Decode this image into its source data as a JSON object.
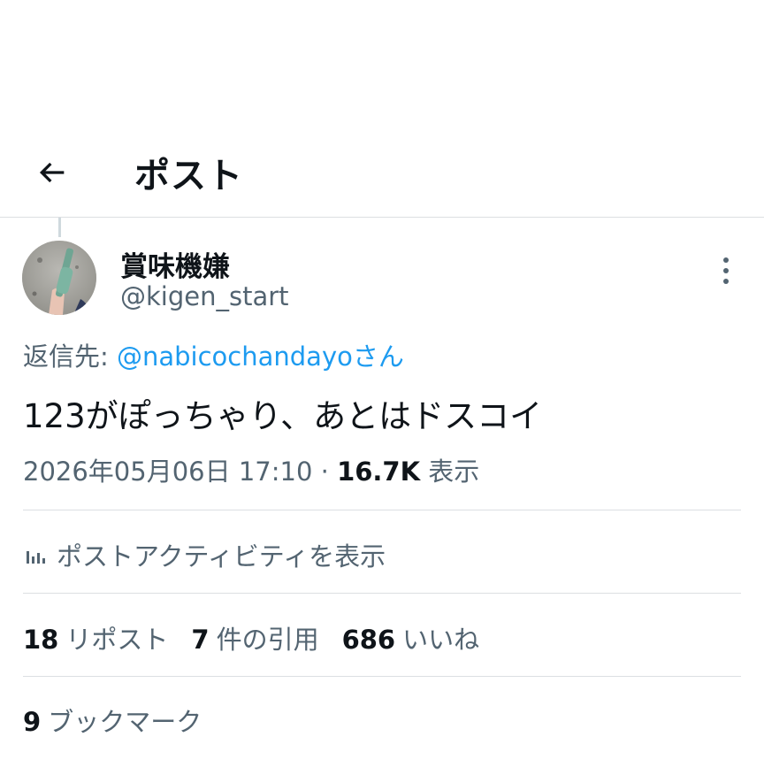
{
  "header": {
    "title": "ポスト",
    "back_icon": "arrow-left-icon"
  },
  "author": {
    "display_name": "賞味機嫌",
    "handle": "@kigen_start"
  },
  "reply": {
    "label": "返信先: ",
    "mention": "@nabicochandayo",
    "suffix": "さん"
  },
  "tweet": {
    "text": "123がぽっちゃり、あとはドスコイ",
    "datetime": "2026年05月06日 17:10",
    "separator": " · ",
    "views_count": "16.7K",
    "views_label": " 表示"
  },
  "activity": {
    "label": "ポストアクティビティを表示",
    "icon": "bar-chart-icon"
  },
  "stats": {
    "reposts_count": "18",
    "reposts_label": "リポスト",
    "quotes_count": "7",
    "quotes_label": "件の引用",
    "likes_count": "686",
    "likes_label": "いいね"
  },
  "bookmarks": {
    "count": "9",
    "label": "ブックマーク"
  },
  "colors": {
    "accent": "#1d9bf0",
    "secondary_text": "#536471",
    "primary_text": "#0f1419",
    "divider": "#dcdfe2"
  }
}
